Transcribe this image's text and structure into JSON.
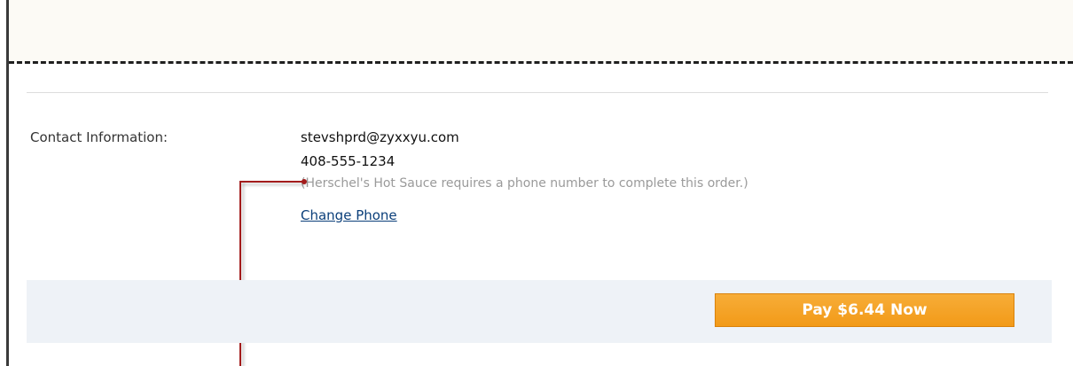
{
  "contact": {
    "label": "Contact Information:",
    "email": "stevshprd@zyxxyu.com",
    "phone": "408-555-1234",
    "note": "(Herschel's Hot Sauce requires a phone number to complete this order.)",
    "change_phone_label": "Change Phone"
  },
  "payment": {
    "pay_button_label": "Pay $6.44 Now"
  },
  "colors": {
    "accent_button": "#f29a18",
    "link": "#0b3f7a",
    "callout": "#a31c1c"
  }
}
